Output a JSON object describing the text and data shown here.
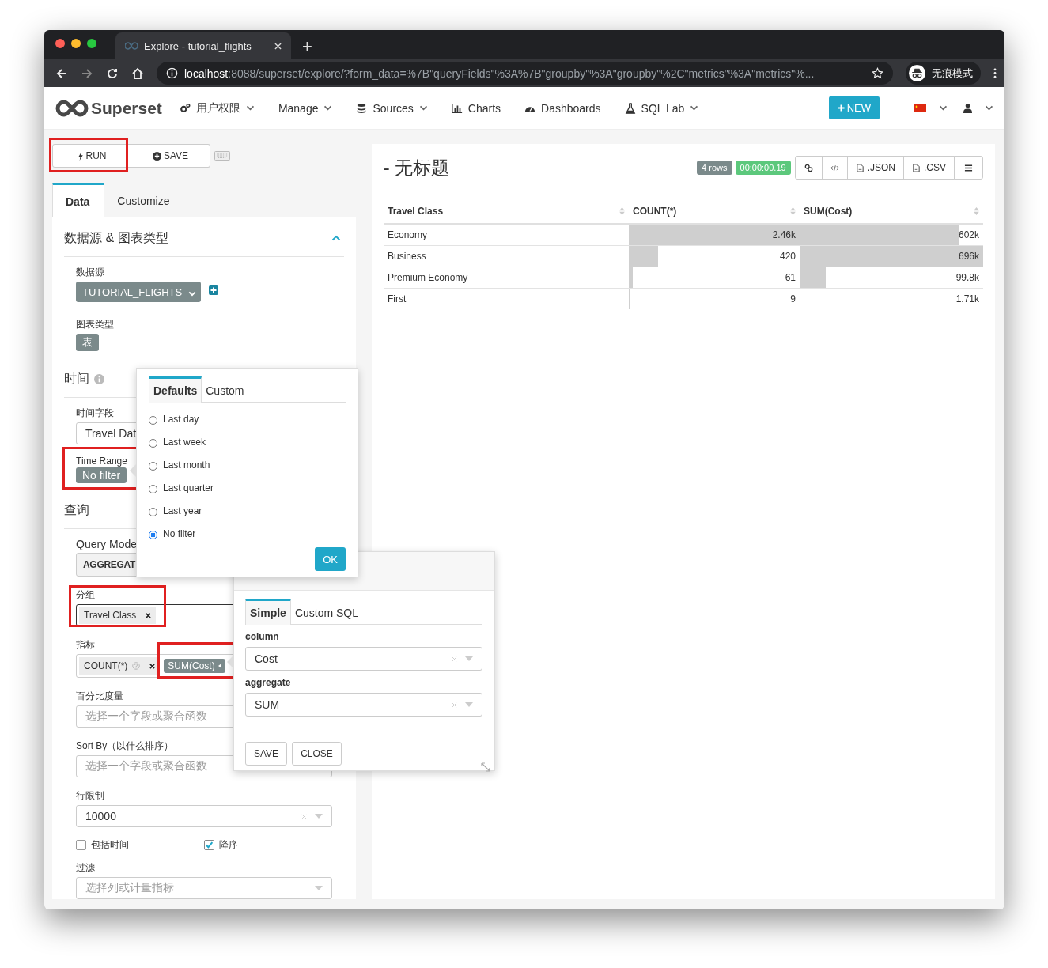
{
  "browser": {
    "tab_title": "Explore - tutorial_flights",
    "new_tab": "+",
    "url_host": "localhost",
    "url_rest": ":8088/superset/explore/?form_data=%7B\"queryFields\"%3A%7B\"groupby\"%3A\"groupby\"%2C\"metrics\"%3A\"metrics\"%...",
    "profile": "无痕模式"
  },
  "navbar": {
    "brand": "Superset",
    "items": [
      {
        "label": "用户权限",
        "dropdown": true
      },
      {
        "label": "Manage",
        "dropdown": true
      },
      {
        "label": "Sources",
        "dropdown": true
      },
      {
        "label": "Charts",
        "dropdown": false
      },
      {
        "label": "Dashboards",
        "dropdown": false
      },
      {
        "label": "SQL Lab",
        "dropdown": true
      }
    ],
    "new_button": "NEW"
  },
  "toolbar": {
    "run": "RUN",
    "save": "SAVE"
  },
  "tabs": [
    {
      "label": "Data",
      "selected": true
    },
    {
      "label": "Customize",
      "selected": false
    }
  ],
  "datasource_section": {
    "title": "数据源 & 图表类型",
    "expanded": true,
    "datasource_label": "数据源",
    "datasource": "TUTORIAL_FLIGHTS",
    "viz_label": "图表类型",
    "viz": "表"
  },
  "time_section": {
    "title": "时间",
    "time_column_label": "时间字段",
    "time_column": "Travel Dat",
    "time_range_label": "Time Range",
    "time_range": "No filter"
  },
  "query_section": {
    "title": "查询",
    "query_mode_label": "Query Mode",
    "query_mode": "AGGREGAT",
    "groupby_label": "分组",
    "groupby": [
      "Travel Class"
    ],
    "metrics_label": "指标",
    "metrics": [
      {
        "label": "COUNT(*)",
        "editing": false
      },
      {
        "label": "SUM(Cost)",
        "editing": true
      }
    ],
    "percent_label": "百分比度量",
    "percent_placeholder": "选择一个字段或聚合函数",
    "sort_label": "Sort By（以什么排序）",
    "sort_placeholder": "选择一个字段或聚合函数",
    "row_limit_label": "行限制",
    "row_limit": "10000",
    "checkboxes": [
      {
        "label": "包括时间",
        "checked": false
      },
      {
        "label": "降序",
        "checked": true
      }
    ],
    "filter_label": "过滤",
    "filter_placeholder": "选择列或计量指标"
  },
  "time_popover": {
    "tabs": [
      {
        "label": "Defaults",
        "selected": true
      },
      {
        "label": "Custom",
        "selected": false
      }
    ],
    "options": [
      {
        "label": "Last day",
        "selected": false
      },
      {
        "label": "Last week",
        "selected": false
      },
      {
        "label": "Last month",
        "selected": false
      },
      {
        "label": "Last quarter",
        "selected": false
      },
      {
        "label": "Last year",
        "selected": false
      },
      {
        "label": "No filter",
        "selected": true
      }
    ],
    "ok": "OK"
  },
  "metric_popover": {
    "tabs": [
      {
        "label": "Simple",
        "selected": true
      },
      {
        "label": "Custom SQL",
        "selected": false
      }
    ],
    "column_label": "column",
    "column": "Cost",
    "aggregate_label": "aggregate",
    "aggregate": "SUM",
    "save": "SAVE",
    "close": "CLOSE"
  },
  "chart": {
    "title": "- 无标题",
    "row_count": "4 rows",
    "duration": "00:00:00.19",
    "actions": [
      ".JSON",
      ".CSV"
    ],
    "table": {
      "columns": [
        "Travel Class",
        "COUNT(*)",
        "SUM(Cost)"
      ],
      "rows": [
        {
          "cells": [
            {
              "text": "Economy"
            },
            {
              "text": "2.46k",
              "level": 1
            },
            {
              "text": "602k",
              "level": 0.865
            }
          ]
        },
        {
          "cells": [
            {
              "text": "Business"
            },
            {
              "text": "420",
              "level": 0.17
            },
            {
              "text": "696k",
              "level": 1
            }
          ]
        },
        {
          "cells": [
            {
              "text": "Premium Economy"
            },
            {
              "text": "61",
              "level": 0.025
            },
            {
              "text": "99.8k",
              "level": 0.143
            }
          ]
        },
        {
          "cells": [
            {
              "text": "First"
            },
            {
              "text": "9",
              "level": 0.004
            },
            {
              "text": "1.71k",
              "level": 0.0025
            }
          ]
        }
      ]
    }
  }
}
